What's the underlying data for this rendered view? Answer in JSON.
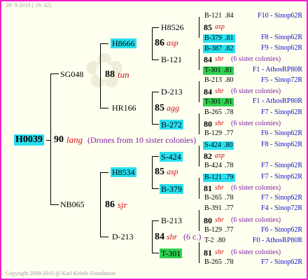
{
  "header": {
    "date": "28-  9-2010 ( 18: 42)"
  },
  "footer": {
    "copyright": "Copyright 2008-2010 @ Karl Kehrle Foundation"
  },
  "root": {
    "id": "H0039",
    "year": "90",
    "breed": "lang",
    "note": "(Drones from 10 sister colonies)"
  },
  "father": {
    "id": "SG048",
    "year": "88",
    "breed": "tun"
  },
  "mother": {
    "id": "NB065",
    "year": "86",
    "breed": "sjr"
  },
  "gen3": [
    {
      "id": "H8666",
      "year": "86",
      "breed": "asp"
    },
    {
      "id": "HR166",
      "year": "85",
      "breed": "agg"
    },
    {
      "id": "H8534",
      "year": "85",
      "breed": "asp"
    },
    {
      "id": "D-213",
      "year": "84",
      "breed": "shr",
      "note": "(6 c.)"
    }
  ],
  "gen4": [
    "H8526",
    "B-121",
    "D-213",
    "B-272",
    "S-424",
    "B-379",
    "B-213",
    "T-301"
  ],
  "gen5": [
    {
      "id": "B-121",
      "yr": ".84",
      "src": "F10 - Sinop62R"
    },
    {
      "id": "85",
      "breed": "asp"
    },
    {
      "id": "B-379",
      "yr": ".81",
      "src": "F8 - Sinop62R"
    },
    {
      "id": "B-387",
      "yr": ".82",
      "src": "F9 - Sinop62R"
    },
    {
      "id": "84",
      "breed": "shr",
      "note": "(6 sister colonies)"
    },
    {
      "id": "T-301",
      "yr": ".81",
      "src": "F1 - AthosRP80R"
    },
    {
      "id": "B-213",
      "yr": ".80",
      "src": "F5 - Sinop72R"
    },
    {
      "id": "84",
      "breed": "shr",
      "note": "(6 sister colonies)"
    },
    {
      "id": "T-301",
      "yr": ".81",
      "src": "F1 - AthosRP80R"
    },
    {
      "id": "B-265",
      "yr": ".78",
      "src": "F7 - Sinop62R"
    },
    {
      "id": "80",
      "breed": "shr",
      "note": "(6 sister colonies)"
    },
    {
      "id": "B-129",
      "yr": ".77",
      "src": "F6 - Sinop62R"
    },
    {
      "id": "S-424",
      "yr": ".80",
      "src": "F8 - Sinop62R"
    },
    {
      "id": "82",
      "breed": "asp"
    },
    {
      "id": "B-424",
      "yr": ".78",
      "src": "F7 - Sinop62R"
    },
    {
      "id": "B-121",
      "yr": ".79",
      "src": "F7 - Sinop62R"
    },
    {
      "id": "81",
      "breed": "shr",
      "note": "(6 sister colonies)"
    },
    {
      "id": "B-265",
      "yr": ".78",
      "src": "F7 - Sinop62R"
    },
    {
      "id": "B-391",
      "yr": ".77",
      "src": "F4 - Sinop72R"
    },
    {
      "id": "80",
      "breed": "shr",
      "note": "(6 sister colonies)"
    },
    {
      "id": "B-129",
      "yr": ".77",
      "src": "F6 - Sinop62R"
    },
    {
      "id": "T-2",
      "yr": ".80",
      "src": "F0 - AthosRP80R"
    },
    {
      "id": "81",
      "breed": "shr",
      "note": "(6 sister colonies)"
    },
    {
      "id": "B-265",
      "yr": ".78",
      "src": "F7 - Sinop62R"
    }
  ]
}
